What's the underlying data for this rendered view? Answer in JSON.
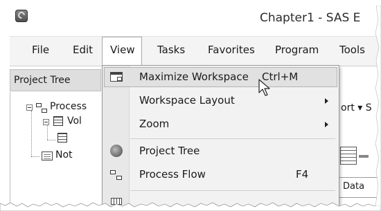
{
  "window": {
    "title": "Chapter1 - SAS E"
  },
  "menubar": {
    "items": [
      {
        "label": "File",
        "name": "menu-file"
      },
      {
        "label": "Edit",
        "name": "menu-edit"
      },
      {
        "label": "View",
        "name": "menu-view",
        "active": true
      },
      {
        "label": "Tasks",
        "name": "menu-tasks"
      },
      {
        "label": "Favorites",
        "name": "menu-favorites"
      },
      {
        "label": "Program",
        "name": "menu-program"
      },
      {
        "label": "Tools",
        "name": "menu-tools"
      }
    ]
  },
  "project_tree": {
    "title": "Project Tree",
    "nodes": [
      {
        "label": "Process",
        "icon": "process-flow-icon"
      },
      {
        "label": "Vol",
        "icon": "data-grid-icon"
      },
      {
        "label": "",
        "icon": "data-table-icon"
      },
      {
        "label": "Not",
        "icon": "notes-icon"
      }
    ]
  },
  "background": {
    "toolbar_fragment": "ort ▾ S",
    "data_label": "Data"
  },
  "view_menu": {
    "items": [
      {
        "label": "Maximize Workspace",
        "shortcut": "Ctrl+M",
        "icon": "maximize-workspace-icon",
        "highlighted": true,
        "submenu": false
      },
      {
        "label": "Workspace Layout",
        "shortcut": "",
        "icon": "",
        "submenu": true
      },
      {
        "label": "Zoom",
        "shortcut": "",
        "icon": "",
        "submenu": true
      },
      {
        "label": "Project Tree",
        "shortcut": "",
        "icon": "project-tree-icon",
        "submenu": false
      },
      {
        "label": "Process Flow",
        "shortcut": "F4",
        "icon": "process-flow-icon",
        "submenu": false
      }
    ]
  },
  "colors": {
    "menubar_bg": "#f4f4f4",
    "menu_bg": "#f2f2f2",
    "highlight_bg": "#e1e1e1",
    "pane_header_bg": "#dedede"
  }
}
